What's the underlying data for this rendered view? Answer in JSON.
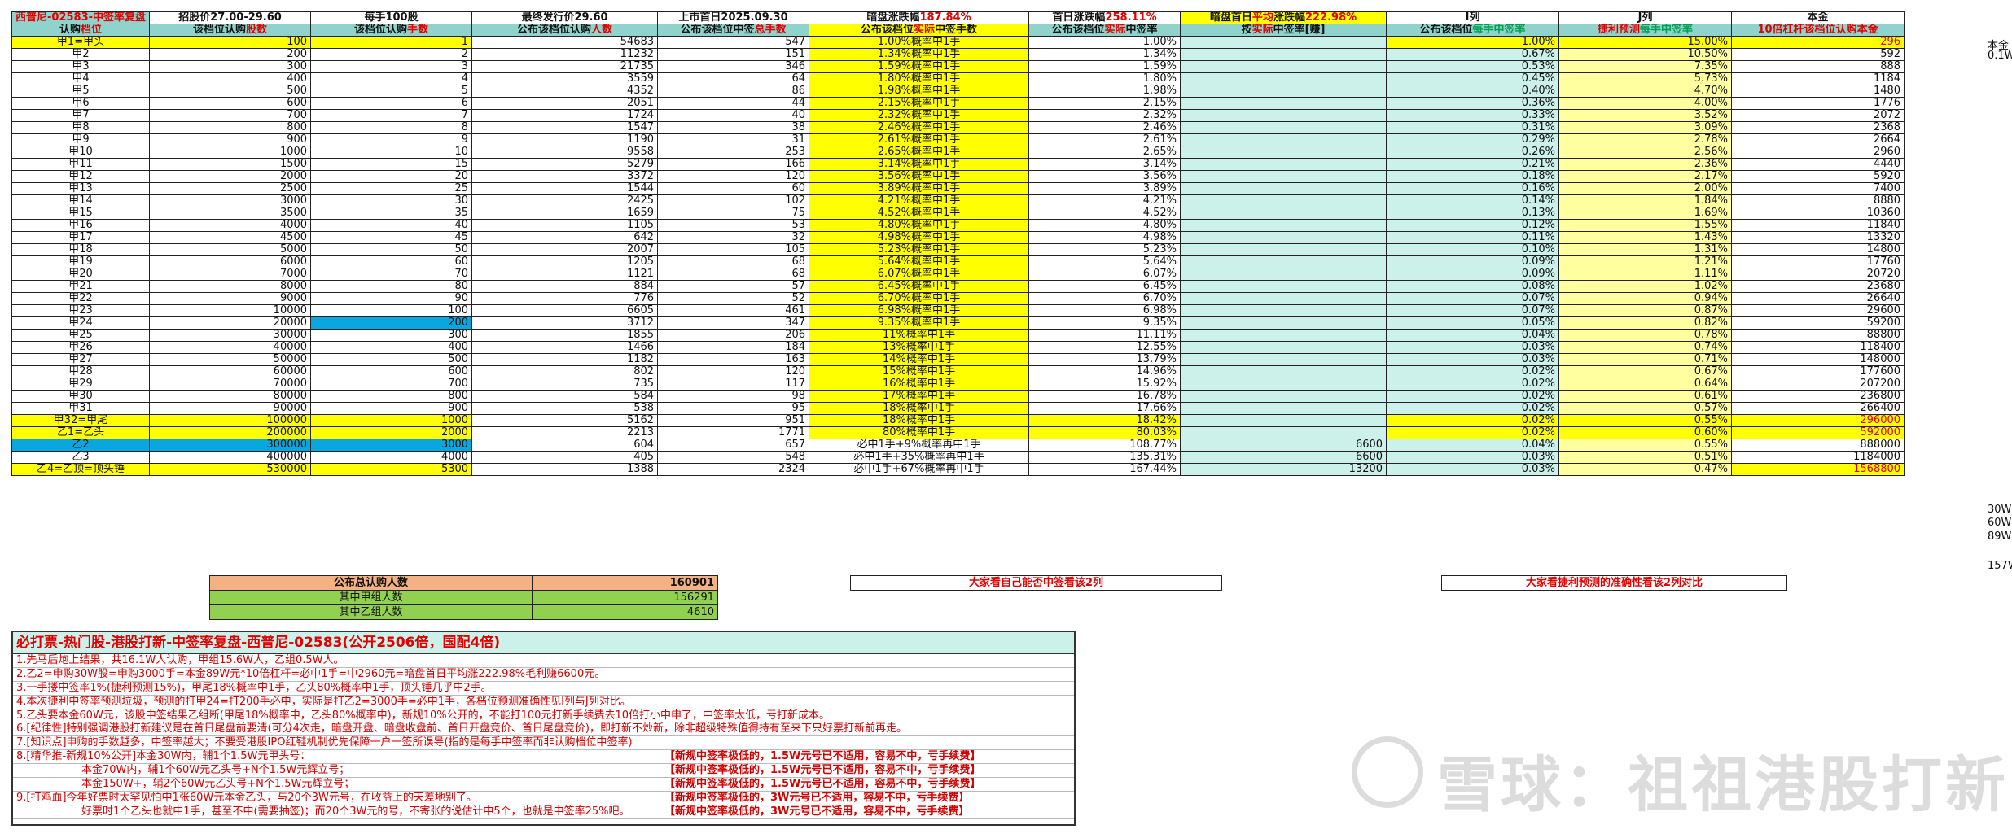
{
  "header": {
    "title": "西普尼-02583-中签率复盘",
    "col_price": "招股价27.00-29.60",
    "col_lot": "每手100股",
    "col_final": "最终发行价29.60",
    "col_date": "上市首日2025.09.30",
    "col_dark_prefix": "暗盘涨跌幅",
    "col_dark_value": "187.84%",
    "col_first_prefix": "首日涨跌幅",
    "col_first_value": "258.11%",
    "col_avg_a": "暗盘首日",
    "col_avg_b": "平均",
    "col_avg_c": "涨跌幅",
    "col_avg_value": "222.98%",
    "col_i": "I列",
    "col_j": "J列",
    "col_capital": "本金"
  },
  "subheader": {
    "c1a": "认购",
    "c1b": "档位",
    "c2a": "该档位认购",
    "c2b": "股数",
    "c3a": "该档位认购",
    "c3b": "手数",
    "c4a": "公布该档位认购",
    "c4b": "人数",
    "c5a": "公布该档位中签",
    "c5b": "总手数",
    "c6a": "公布该档位",
    "c6b": "实际",
    "c6c": "中签手数",
    "c7a": "公布该档位",
    "c7b": "实际",
    "c7c": "中签率",
    "c8a": "按",
    "c8b": "实际",
    "c8c": "中签率[赚]",
    "c9a": "公布该档位",
    "c9b": "每手中签率",
    "c10a": "捷利预测",
    "c10b": "每手中签率",
    "c11a": "10倍杠杆该档位认购",
    "c11b": "本金"
  },
  "rows": [
    [
      "甲1=甲头",
      "100",
      "1",
      "54683",
      "547",
      "1.00%概率中1手",
      "1.00%",
      "",
      "1.00%",
      "15.00%",
      "296"
    ],
    [
      "甲2",
      "200",
      "2",
      "11232",
      "151",
      "1.34%概率中1手",
      "1.34%",
      "",
      "0.67%",
      "10.50%",
      "592"
    ],
    [
      "甲3",
      "300",
      "3",
      "21735",
      "346",
      "1.59%概率中1手",
      "1.59%",
      "",
      "0.53%",
      "7.35%",
      "888"
    ],
    [
      "甲4",
      "400",
      "4",
      "3559",
      "64",
      "1.80%概率中1手",
      "1.80%",
      "",
      "0.45%",
      "5.73%",
      "1184"
    ],
    [
      "甲5",
      "500",
      "5",
      "4352",
      "86",
      "1.98%概率中1手",
      "1.98%",
      "",
      "0.40%",
      "4.70%",
      "1480"
    ],
    [
      "甲6",
      "600",
      "6",
      "2051",
      "44",
      "2.15%概率中1手",
      "2.15%",
      "",
      "0.36%",
      "4.00%",
      "1776"
    ],
    [
      "甲7",
      "700",
      "7",
      "1724",
      "40",
      "2.32%概率中1手",
      "2.32%",
      "",
      "0.33%",
      "3.52%",
      "2072"
    ],
    [
      "甲8",
      "800",
      "8",
      "1547",
      "38",
      "2.46%概率中1手",
      "2.46%",
      "",
      "0.31%",
      "3.09%",
      "2368"
    ],
    [
      "甲9",
      "900",
      "9",
      "1190",
      "31",
      "2.61%概率中1手",
      "2.61%",
      "",
      "0.29%",
      "2.78%",
      "2664"
    ],
    [
      "甲10",
      "1000",
      "10",
      "9558",
      "253",
      "2.65%概率中1手",
      "2.65%",
      "",
      "0.26%",
      "2.56%",
      "2960"
    ],
    [
      "甲11",
      "1500",
      "15",
      "5279",
      "166",
      "3.14%概率中1手",
      "3.14%",
      "",
      "0.21%",
      "2.36%",
      "4440"
    ],
    [
      "甲12",
      "2000",
      "20",
      "3372",
      "120",
      "3.56%概率中1手",
      "3.56%",
      "",
      "0.18%",
      "2.17%",
      "5920"
    ],
    [
      "甲13",
      "2500",
      "25",
      "1544",
      "60",
      "3.89%概率中1手",
      "3.89%",
      "",
      "0.16%",
      "2.00%",
      "7400"
    ],
    [
      "甲14",
      "3000",
      "30",
      "2425",
      "102",
      "4.21%概率中1手",
      "4.21%",
      "",
      "0.14%",
      "1.84%",
      "8880"
    ],
    [
      "甲15",
      "3500",
      "35",
      "1659",
      "75",
      "4.52%概率中1手",
      "4.52%",
      "",
      "0.13%",
      "1.69%",
      "10360"
    ],
    [
      "甲16",
      "4000",
      "40",
      "1105",
      "53",
      "4.80%概率中1手",
      "4.80%",
      "",
      "0.12%",
      "1.55%",
      "11840"
    ],
    [
      "甲17",
      "4500",
      "45",
      "642",
      "32",
      "4.98%概率中1手",
      "4.98%",
      "",
      "0.11%",
      "1.43%",
      "13320"
    ],
    [
      "甲18",
      "5000",
      "50",
      "2007",
      "105",
      "5.23%概率中1手",
      "5.23%",
      "",
      "0.10%",
      "1.31%",
      "14800"
    ],
    [
      "甲19",
      "6000",
      "60",
      "1205",
      "68",
      "5.64%概率中1手",
      "5.64%",
      "",
      "0.09%",
      "1.21%",
      "17760"
    ],
    [
      "甲20",
      "7000",
      "70",
      "1121",
      "68",
      "6.07%概率中1手",
      "6.07%",
      "",
      "0.09%",
      "1.11%",
      "20720"
    ],
    [
      "甲21",
      "8000",
      "80",
      "884",
      "57",
      "6.45%概率中1手",
      "6.45%",
      "",
      "0.08%",
      "1.02%",
      "23680"
    ],
    [
      "甲22",
      "9000",
      "90",
      "776",
      "52",
      "6.70%概率中1手",
      "6.70%",
      "",
      "0.07%",
      "0.94%",
      "26640"
    ],
    [
      "甲23",
      "10000",
      "100",
      "6605",
      "461",
      "6.98%概率中1手",
      "6.98%",
      "",
      "0.07%",
      "0.87%",
      "29600"
    ],
    [
      "甲24",
      "20000",
      "200",
      "3712",
      "347",
      "9.35%概率中1手",
      "9.35%",
      "",
      "0.05%",
      "0.82%",
      "59200"
    ],
    [
      "甲25",
      "30000",
      "300",
      "1855",
      "206",
      "11%概率中1手",
      "11.11%",
      "",
      "0.04%",
      "0.78%",
      "88800"
    ],
    [
      "甲26",
      "40000",
      "400",
      "1466",
      "184",
      "13%概率中1手",
      "12.55%",
      "",
      "0.03%",
      "0.74%",
      "118400"
    ],
    [
      "甲27",
      "50000",
      "500",
      "1182",
      "163",
      "14%概率中1手",
      "13.79%",
      "",
      "0.03%",
      "0.71%",
      "148000"
    ],
    [
      "甲28",
      "60000",
      "600",
      "802",
      "120",
      "15%概率中1手",
      "14.96%",
      "",
      "0.02%",
      "0.67%",
      "177600"
    ],
    [
      "甲29",
      "70000",
      "700",
      "735",
      "117",
      "16%概率中1手",
      "15.92%",
      "",
      "0.02%",
      "0.64%",
      "207200"
    ],
    [
      "甲30",
      "80000",
      "800",
      "584",
      "98",
      "17%概率中1手",
      "16.78%",
      "",
      "0.02%",
      "0.61%",
      "236800"
    ],
    [
      "甲31",
      "90000",
      "900",
      "538",
      "95",
      "18%概率中1手",
      "17.66%",
      "",
      "0.02%",
      "0.57%",
      "266400"
    ],
    [
      "甲32=甲尾",
      "100000",
      "1000",
      "5162",
      "951",
      "18%概率中1手",
      "18.42%",
      "",
      "0.02%",
      "0.55%",
      "296000"
    ],
    [
      "乙1=乙头",
      "200000",
      "2000",
      "2213",
      "1771",
      "80%概率中1手",
      "80.03%",
      "",
      "0.02%",
      "0.60%",
      "592000"
    ],
    [
      "乙2",
      "300000",
      "3000",
      "604",
      "657",
      "必中1手+9%概率再中1手",
      "108.77%",
      "6600",
      "0.04%",
      "0.55%",
      "888000"
    ],
    [
      "乙3",
      "400000",
      "4000",
      "405",
      "548",
      "必中1手+35%概率再中1手",
      "135.31%",
      "6600",
      "0.03%",
      "0.51%",
      "1184000"
    ],
    [
      "乙4=乙顶=顶头锤",
      "530000",
      "5300",
      "1388",
      "2324",
      "必中1手+67%概率再中1手",
      "167.44%",
      "13200",
      "0.03%",
      "0.47%",
      "1568800"
    ]
  ],
  "summary": {
    "total_label": "公布总认购人数",
    "total_value": "160901",
    "a_label": "其中甲组人数",
    "a_value": "156291",
    "b_label": "其中乙组人数",
    "b_value": "4610",
    "note_left": "大家看自己能否中签看该2列",
    "note_right": "大家看捷利预测的准确性看该2列对比"
  },
  "side_labels": {
    "top_label": "本金",
    "top_value": "0.1W",
    "v30": "30W",
    "v60": "60W",
    "v89": "89W",
    "v157": "157W"
  },
  "notes": {
    "title": "必打票-热门股-港股打新-中签率复盘-西普尼-02583(公开2506倍，国配4倍)",
    "lines": [
      "1.先马后炮上结果，共16.1W人认购，甲组15.6W人，乙组0.5W人。",
      "2.乙2=申购30W股=申购3000手=本金89W元*10倍杠杆=必中1手=中2960元=暗盘首日平均涨222.98%毛利赚6600元。",
      "3.一手搂中签率1%(捷利预测15%)，甲尾18%概率中1手，乙头80%概率中1手，顶头锤几乎中2手。",
      "4.本次捷利中签率预测垃圾，预测的打甲24=打200手必中，实际是打乙2=3000手=必中1手，各档位预测准确性见I列与J列对比。",
      "5.乙头要本金60W元，该股中签结果乙组断(甲尾18%概率中，乙头80%概率中)，新规10%公开的，不能打100元打新手续费去10倍打小中申了，中签率太低，亏打新成本。",
      "6.[纪律性]特别强调港股打新建议是在首日尾盘前要清(可分4次走，暗盘开盘、暗盘收盘前、首日开盘竞价、首日尾盘竞价)，即打新不炒新，除非超级特殊值得持有至来下只好票打新前再走。",
      "7.[知识点]申购的手数越多，中签率越大；不要受港股IPO红鞋机制优先保障一户一签所误导(指的是每手中签率而非认购档位中签率)",
      "8.[精华推-新规10%公开]本金30W内，辅1个1.5W元甲头号：",
      "本金70W内，辅1个60W元乙头号+N个1.5W元辉立号；",
      "本金150W+，辅2个60W元乙头号+N个1.5W元辉立号；",
      "9.[打鸡血]今年好票时太罕见怕中1张60W元本金乙头，与20个3W元号，在收益上的天差地别了。",
      "好票时1个乙头也就中1手，甚至不中(需要抽签)；而20个3W元的号，不寄张的说估计中5个，也就是中签率25%吧。"
    ],
    "right_tag": "【新规中签率极低的，1.5W元号已不适用，容易不中，亏手续费】",
    "right_tag_b": "【新规中签率极低的，3W元号已不适用，容易不中，亏手续费】"
  },
  "watermark": "雪球：祖祖港股打新"
}
